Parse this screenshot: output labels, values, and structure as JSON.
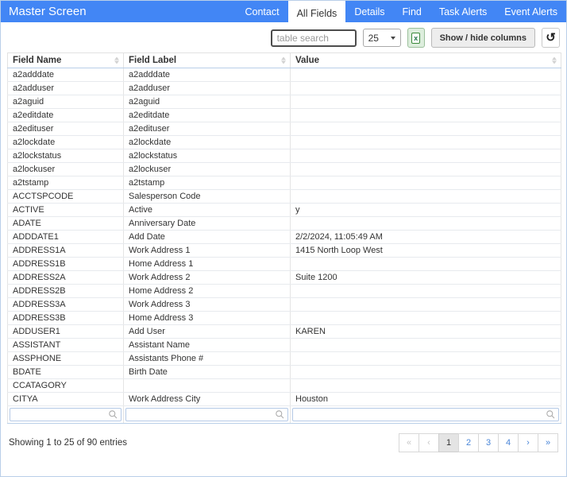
{
  "header": {
    "title": "Master Screen",
    "tabs": [
      {
        "label": "Contact",
        "active": false
      },
      {
        "label": "All Fields",
        "active": true
      },
      {
        "label": "Details",
        "active": false
      },
      {
        "label": "Find",
        "active": false
      },
      {
        "label": "Task Alerts",
        "active": false
      },
      {
        "label": "Event Alerts",
        "active": false
      }
    ]
  },
  "toolbar": {
    "search_placeholder": "table search",
    "page_size_selected": "25",
    "excel_icon_glyph": "x",
    "show_hide_columns_label": "Show / hide columns",
    "refresh_icon_glyph": "↺"
  },
  "table": {
    "columns": [
      "Field Name",
      "Field Label",
      "Value"
    ],
    "rows": [
      {
        "field_name": "a2adddate",
        "field_label": "a2adddate",
        "value": ""
      },
      {
        "field_name": "a2adduser",
        "field_label": "a2adduser",
        "value": ""
      },
      {
        "field_name": "a2aguid",
        "field_label": "a2aguid",
        "value": ""
      },
      {
        "field_name": "a2editdate",
        "field_label": "a2editdate",
        "value": ""
      },
      {
        "field_name": "a2edituser",
        "field_label": "a2edituser",
        "value": ""
      },
      {
        "field_name": "a2lockdate",
        "field_label": "a2lockdate",
        "value": ""
      },
      {
        "field_name": "a2lockstatus",
        "field_label": "a2lockstatus",
        "value": ""
      },
      {
        "field_name": "a2lockuser",
        "field_label": "a2lockuser",
        "value": ""
      },
      {
        "field_name": "a2tstamp",
        "field_label": "a2tstamp",
        "value": ""
      },
      {
        "field_name": "ACCTSPCODE",
        "field_label": "Salesperson Code",
        "value": ""
      },
      {
        "field_name": "ACTIVE",
        "field_label": "Active",
        "value": "y"
      },
      {
        "field_name": "ADATE",
        "field_label": "Anniversary Date",
        "value": ""
      },
      {
        "field_name": "ADDDATE1",
        "field_label": "Add Date",
        "value": "2/2/2024, 11:05:49 AM"
      },
      {
        "field_name": "ADDRESS1A",
        "field_label": "Work Address 1",
        "value": "1415 North Loop West"
      },
      {
        "field_name": "ADDRESS1B",
        "field_label": "Home Address 1",
        "value": ""
      },
      {
        "field_name": "ADDRESS2A",
        "field_label": "Work Address 2",
        "value": "Suite 1200"
      },
      {
        "field_name": "ADDRESS2B",
        "field_label": "Home Address 2",
        "value": ""
      },
      {
        "field_name": "ADDRESS3A",
        "field_label": "Work Address 3",
        "value": ""
      },
      {
        "field_name": "ADDRESS3B",
        "field_label": "Home Address 3",
        "value": ""
      },
      {
        "field_name": "ADDUSER1",
        "field_label": "Add User",
        "value": "KAREN"
      },
      {
        "field_name": "ASSISTANT",
        "field_label": "Assistant Name",
        "value": ""
      },
      {
        "field_name": "ASSPHONE",
        "field_label": "Assistants Phone #",
        "value": ""
      },
      {
        "field_name": "BDATE",
        "field_label": "Birth Date",
        "value": ""
      },
      {
        "field_name": "CCATAGORY",
        "field_label": "",
        "value": ""
      },
      {
        "field_name": "CITYA",
        "field_label": "Work Address City",
        "value": "Houston"
      }
    ]
  },
  "footer": {
    "summary": "Showing 1 to 25 of 90 entries",
    "pagination": [
      {
        "label": "«",
        "state": "disabled"
      },
      {
        "label": "‹",
        "state": "disabled"
      },
      {
        "label": "1",
        "state": "active"
      },
      {
        "label": "2",
        "state": "link"
      },
      {
        "label": "3",
        "state": "link"
      },
      {
        "label": "4",
        "state": "link"
      },
      {
        "label": "›",
        "state": "link"
      },
      {
        "label": "»",
        "state": "link"
      }
    ]
  },
  "colors": {
    "header_blue": "#4286f5",
    "link_blue": "#4a86d8",
    "excel_green": "#217346",
    "filter_border_blue": "#b4c9e6"
  }
}
